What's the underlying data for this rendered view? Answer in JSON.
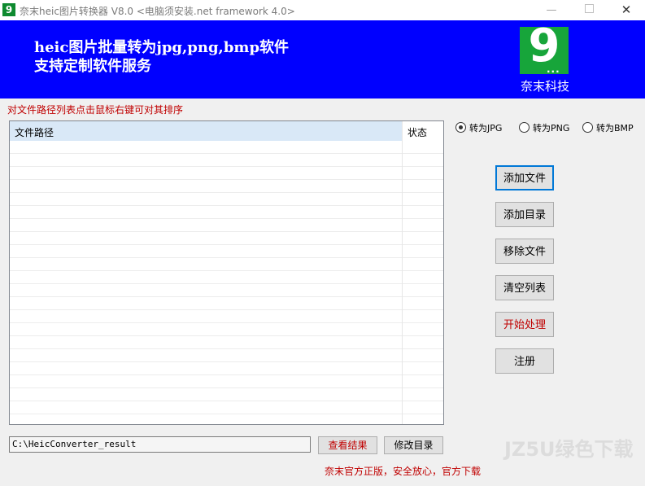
{
  "window": {
    "title": "奈末heic图片转换器 V8.0  <电脑须安装.net framework 4.0>",
    "app_icon_glyph": "9",
    "minimize_glyph": "—",
    "close_glyph": "✕"
  },
  "banner": {
    "line1": "heic图片批量转为jpg,png,bmp软件",
    "line2": "支持定制软件服务",
    "logo_glyph": "9",
    "logo_dots": "...",
    "logo_name": "奈末科技",
    "bg_color": "#0000ff",
    "logo_color": "#17a53a"
  },
  "hint": "对文件路径列表点击鼠标右键可对其排序",
  "list": {
    "columns": [
      "文件路径",
      "状态"
    ],
    "rows": []
  },
  "format": {
    "options": [
      "转为JPG",
      "转为PNG",
      "转为BMP"
    ],
    "selected": "转为JPG"
  },
  "buttons": {
    "add_file": "添加文件",
    "add_dir": "添加目录",
    "remove_file": "移除文件",
    "clear_list": "清空列表",
    "start": "开始处理",
    "register": "注册"
  },
  "output": {
    "path": "C:\\HeicConverter_result",
    "view_result": "查看结果",
    "change_dir": "修改目录"
  },
  "footer": "奈末官方正版，安全放心，官方下载",
  "watermark": "JZ5U绿色下载"
}
